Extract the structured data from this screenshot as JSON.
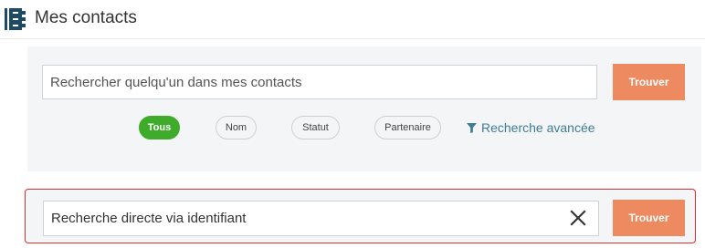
{
  "header": {
    "title": "Mes contacts",
    "logo_icon": "address-book-icon"
  },
  "search": {
    "placeholder": "Rechercher quelqu'un dans mes contacts",
    "submit_label": "Trouver",
    "filters": [
      {
        "label": "Tous",
        "active": true
      },
      {
        "label": "Nom",
        "active": false
      },
      {
        "label": "Statut",
        "active": false
      },
      {
        "label": "Partenaire",
        "active": false
      }
    ],
    "advanced_label": "Recherche avancée",
    "advanced_icon": "filter-icon"
  },
  "direct_search": {
    "value": "Recherche directe via identifiant",
    "clear_icon": "close-icon",
    "submit_label": "Trouver"
  },
  "colors": {
    "accent_button": "#ee8a5f",
    "active_filter": "#3eab2a",
    "link": "#3f7d97",
    "highlight_border": "#d9302e",
    "logo": "#1f4a63"
  }
}
